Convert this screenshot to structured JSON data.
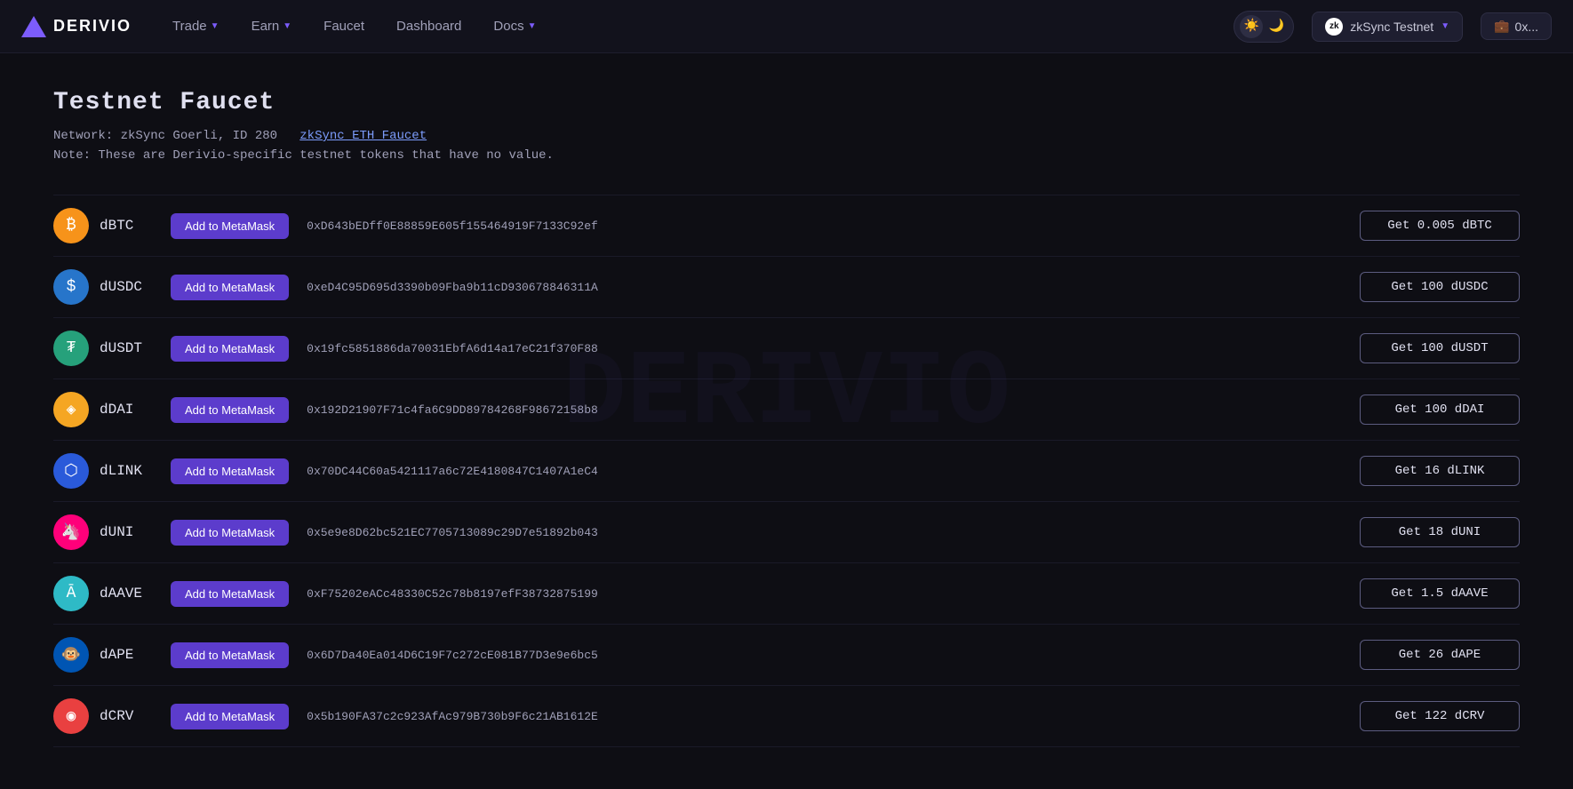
{
  "nav": {
    "logo_text": "DERIVIO",
    "items": [
      {
        "label": "Trade",
        "has_dropdown": true
      },
      {
        "label": "Earn",
        "has_dropdown": true
      },
      {
        "label": "Faucet",
        "has_dropdown": false
      },
      {
        "label": "Dashboard",
        "has_dropdown": false
      },
      {
        "label": "Docs",
        "has_dropdown": true
      }
    ],
    "theme_toggle": {
      "sun": "☀",
      "moon": "🌙"
    },
    "network": {
      "name": "zkSync Testnet",
      "icon": "zk"
    },
    "wallet": {
      "label": "0x...",
      "icon": "💼"
    }
  },
  "page": {
    "title": "Testnet Faucet",
    "network_label": "Network: zkSync Goerli, ID 280",
    "faucet_link": "zkSync ETH Faucet",
    "note": "Note: These are Derivio-specific testnet tokens that have no value.",
    "tokens": [
      {
        "symbol": "dBTC",
        "icon_class": "icon-btc",
        "icon_text": "₿",
        "metamask_label": "Add to MetaMask",
        "address": "0xD643bEDff0E88859E605f155464919F7133C92ef",
        "get_label": "Get 0.005 dBTC"
      },
      {
        "symbol": "dUSDC",
        "icon_class": "icon-usdc",
        "icon_text": "$",
        "metamask_label": "Add to MetaMask",
        "address": "0xeD4C95D695d3390b09Fba9b11cD930678846311A",
        "get_label": "Get 100 dUSDC"
      },
      {
        "symbol": "dUSDT",
        "icon_class": "icon-usdt",
        "icon_text": "₮",
        "metamask_label": "Add to MetaMask",
        "address": "0x19fc5851886da70031EbfA6d14a17eC21f370F88",
        "get_label": "Get 100 dUSDT"
      },
      {
        "symbol": "dDAI",
        "icon_class": "icon-dai",
        "icon_text": "◈",
        "metamask_label": "Add to MetaMask",
        "address": "0x192D21907F71c4fa6C9DD89784268F98672158b8",
        "get_label": "Get 100 dDAI"
      },
      {
        "symbol": "dLINK",
        "icon_class": "icon-link",
        "icon_text": "⬡",
        "metamask_label": "Add to MetaMask",
        "address": "0x70DC44C60a5421117a6c72E4180847C1407A1eC4",
        "get_label": "Get 16 dLINK"
      },
      {
        "symbol": "dUNI",
        "icon_class": "icon-uni",
        "icon_text": "🦄",
        "metamask_label": "Add to MetaMask",
        "address": "0x5e9e8D62bc521EC7705713089c29D7e51892b043",
        "get_label": "Get 18 dUNI"
      },
      {
        "symbol": "dAAVE",
        "icon_class": "icon-aave",
        "icon_text": "Ā",
        "metamask_label": "Add to MetaMask",
        "address": "0xF75202eACc48330C52c78b8197efF38732875199",
        "get_label": "Get 1.5 dAAVE"
      },
      {
        "symbol": "dAPE",
        "icon_class": "icon-ape",
        "icon_text": "🐵",
        "metamask_label": "Add to MetaMask",
        "address": "0x6D7Da40Ea014D6C19F7c272cE081B77D3e9e6bc5",
        "get_label": "Get 26 dAPE"
      },
      {
        "symbol": "dCRV",
        "icon_class": "icon-crv",
        "icon_text": "◉",
        "metamask_label": "Add to MetaMask",
        "address": "0x5b190FA37c2c923AfAc979B730b9F6c21AB1612E",
        "get_label": "Get 122 dCRV"
      }
    ]
  }
}
